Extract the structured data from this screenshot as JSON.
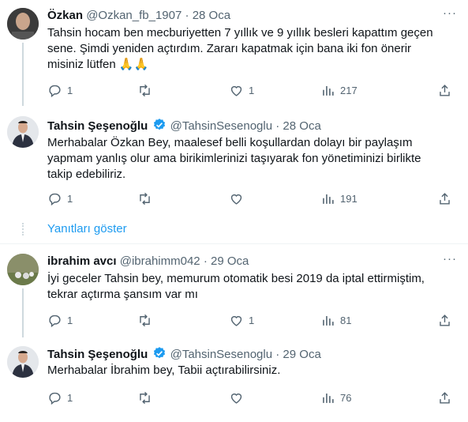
{
  "tweets": [
    {
      "name": "Özkan",
      "handle": "@Ozkan_fb_1907",
      "separator": "·",
      "date": "28 Oca",
      "text": "Tahsin hocam ben mecburiyetten 7 yıllık ve 9 yıllık besleri kapattım geçen sene. Şimdi yeniden açtırdım. Zararı kapatmak için bana iki fon önerir misiniz lütfen 🙏🙏",
      "replies": "1",
      "retweets": "",
      "likes": "1",
      "views": "217"
    },
    {
      "name": "Tahsin Şeşenoğlu",
      "handle": "@TahsinSesenoglu",
      "separator": "·",
      "date": "28 Oca",
      "text": "Merhabalar Özkan Bey, maalesef belli koşullardan dolayı bir paylaşım yapmam yanlış olur ama birikimlerinizi taşıyarak fon yönetiminizi birlikte takip edebiliriz.",
      "replies": "1",
      "retweets": "",
      "likes": "",
      "views": "191"
    },
    {
      "name": "ibrahim avcı",
      "handle": "@ibrahimm042",
      "separator": "·",
      "date": "29 Oca",
      "text": "İyi geceler Tahsin bey, memurum otomatik besi 2019 da iptal ettirmiştim, tekrar açtırma şansım var mı",
      "replies": "1",
      "retweets": "",
      "likes": "1",
      "views": "81"
    },
    {
      "name": "Tahsin Şeşenoğlu",
      "handle": "@TahsinSesenoglu",
      "separator": "·",
      "date": "29 Oca",
      "text": "Merhabalar İbrahim bey, Tabii açtırabilirsiniz.",
      "replies": "1",
      "retweets": "",
      "likes": "",
      "views": "76"
    }
  ],
  "show_replies_label": "Yanıtları göster",
  "more_label": "···",
  "colors": {
    "accent": "#1d9bf0",
    "secondary_text": "#536471",
    "divider": "#eff3f4"
  }
}
